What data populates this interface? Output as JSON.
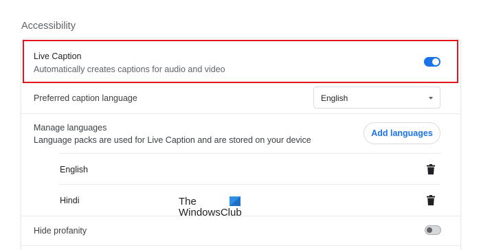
{
  "section": {
    "title": "Accessibility"
  },
  "live_caption": {
    "title": "Live Caption",
    "subtitle": "Automatically creates captions for audio and video",
    "enabled": true
  },
  "caption_language": {
    "label": "Preferred caption language",
    "selected": "English"
  },
  "manage_languages": {
    "title": "Manage languages",
    "subtitle": "Language packs are used for Live Caption and are stored on your device",
    "add_button": "Add languages",
    "languages": [
      "English",
      "Hindi"
    ]
  },
  "hide_profanity": {
    "label": "Hide profanity",
    "enabled": false
  },
  "watermark": {
    "line1": "The",
    "line2": "WindowsClub"
  },
  "colors": {
    "accent": "#1a73e8",
    "highlight": "#e3141a"
  }
}
